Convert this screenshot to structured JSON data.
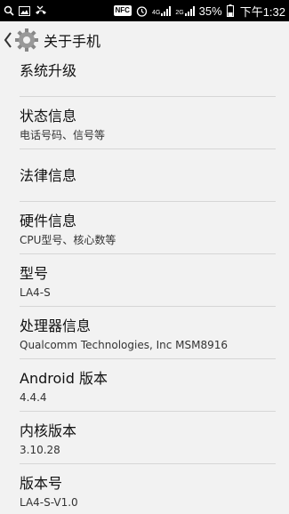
{
  "status_bar": {
    "nfc_label": "NFC",
    "network_1": "4G",
    "network_2": "2G",
    "battery_percent": "35%",
    "time": "下午1:32"
  },
  "action_bar": {
    "title": "关于手机",
    "back_icon": "chevron-left-icon",
    "app_icon": "gear-icon"
  },
  "items": [
    {
      "title": "系统升级"
    },
    {
      "title": "状态信息",
      "subtitle": "电话号码、信号等"
    },
    {
      "title": "法律信息"
    },
    {
      "title": "硬件信息",
      "subtitle": "CPU型号、核心数等"
    },
    {
      "title": "型号",
      "subtitle": "LA4-S"
    },
    {
      "title": "处理器信息",
      "subtitle": "Qualcomm Technologies, Inc MSM8916"
    },
    {
      "title": "Android 版本",
      "subtitle": "4.4.4"
    },
    {
      "title": "内核版本",
      "subtitle": "3.10.28"
    },
    {
      "title": "版本号",
      "subtitle": "LA4-S-V1.0"
    }
  ]
}
